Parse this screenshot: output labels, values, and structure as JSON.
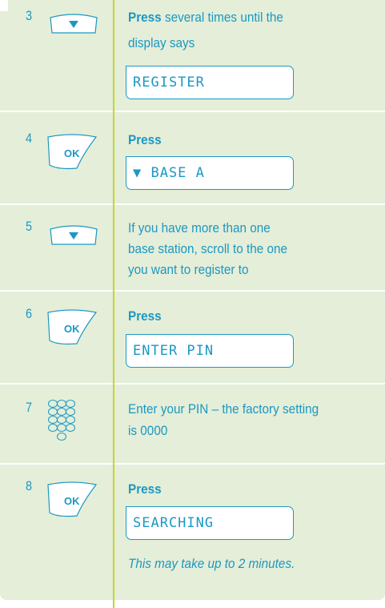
{
  "steps": [
    {
      "number": "3",
      "key": "down-arrow-key",
      "bold": "Press",
      "text": " several times until the",
      "line2": "display says",
      "display": "REGISTER"
    },
    {
      "number": "4",
      "key": "ok-key",
      "bold": "Press",
      "display": "▼ BASE A"
    },
    {
      "number": "5",
      "key": "down-arrow-key",
      "lines": [
        "If you have more than one",
        "base station, scroll to the one",
        "you want to register to"
      ]
    },
    {
      "number": "6",
      "key": "ok-key",
      "bold": "Press",
      "display": "ENTER PIN"
    },
    {
      "number": "7",
      "key": "keypad",
      "lines": [
        "Enter your PIN – the factory setting",
        "is 0000"
      ]
    },
    {
      "number": "8",
      "key": "ok-key",
      "bold": "Press",
      "display": "SEARCHING",
      "note": "This may take up to 2 minutes."
    }
  ],
  "key_labels": {
    "ok": "OK"
  },
  "colors": {
    "text": "#1b98c4",
    "rule": "#c4d62a",
    "panel": "#e5eed8"
  }
}
